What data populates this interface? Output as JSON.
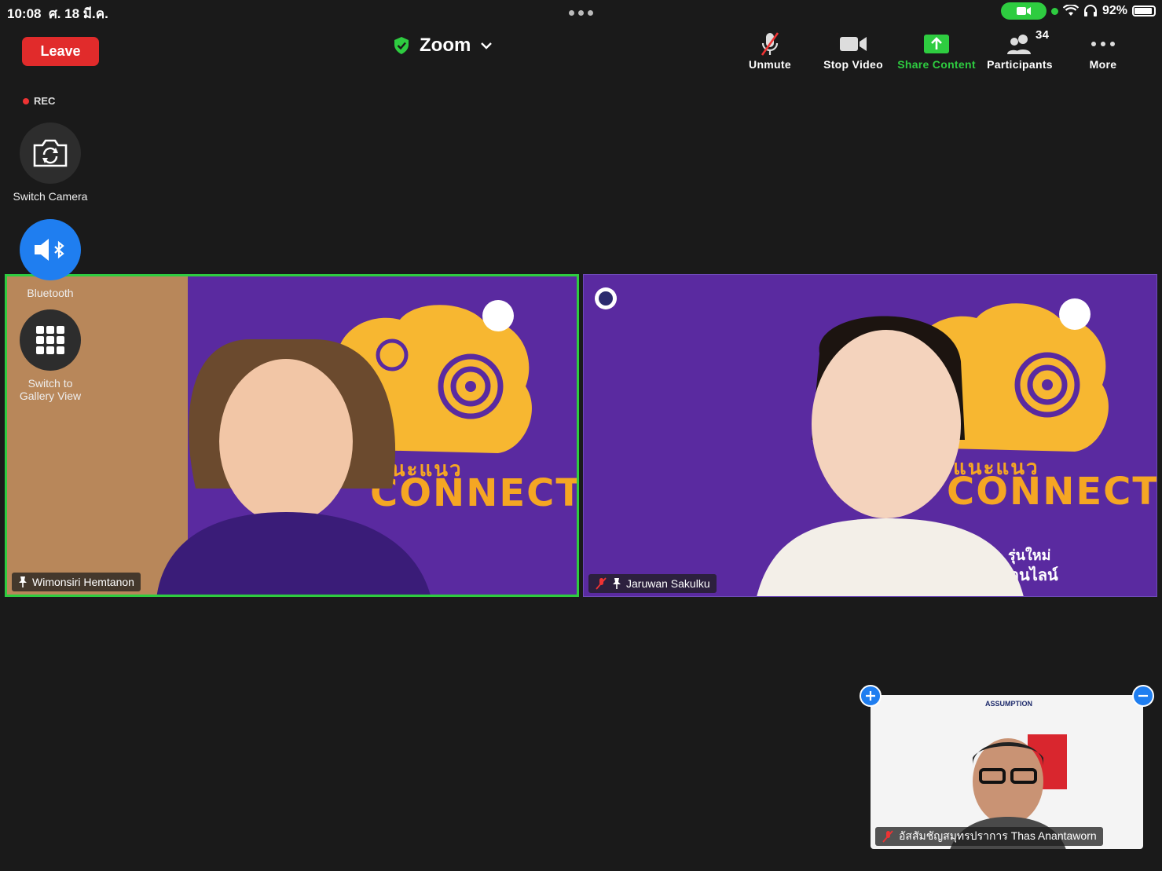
{
  "status_bar": {
    "time": "10:08",
    "date": "ศ. 18 มี.ค.",
    "battery": "92%",
    "battery_level": 0.92
  },
  "toolbar": {
    "leave": "Leave",
    "meeting_title": "Zoom",
    "unmute": "Unmute",
    "stop_video": "Stop Video",
    "share_content": "Share Content",
    "participants": "Participants",
    "participant_count": "34",
    "more": "More"
  },
  "side": {
    "rec": "REC",
    "switch_camera": "Switch Camera",
    "bluetooth": "Bluetooth",
    "gallery_line1": "Switch to",
    "gallery_line2": "Gallery View"
  },
  "tiles": [
    {
      "name": "Wimonsiri Hemtanon",
      "bg_text_top": "แนะแนว",
      "bg_text": "CONNECT"
    },
    {
      "name": "Jaruwan Sakulku",
      "bg_text_top": "แนะแนว",
      "bg_text": "CONNECT",
      "line1": "รุ่นใหม่",
      "line2": "ออนไลน์"
    }
  ],
  "pip": {
    "name": "อัสสัมชัญสมุทรปราการ Thas Anantaworn",
    "header": "ASSUMPTION"
  },
  "colors": {
    "leave": "#e12b2b",
    "accent_green": "#2ecc40",
    "blue": "#1f7ef0",
    "tile_purple": "#5a2aa0"
  }
}
